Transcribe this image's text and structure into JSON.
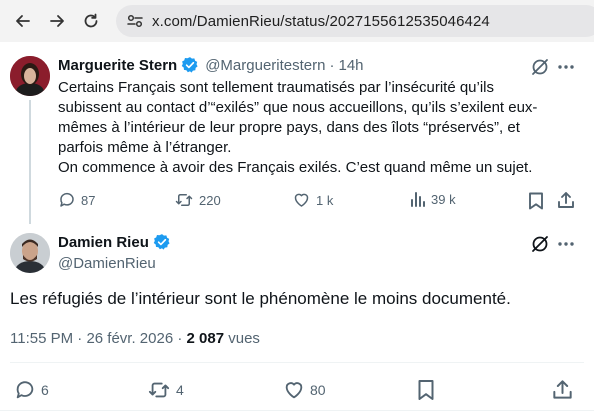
{
  "browser": {
    "url": "x.com/DamienRieu/status/2027155612535046424"
  },
  "parent_tweet": {
    "author_name": "Marguerite Stern",
    "author_handle": "@Margueritestern",
    "separator": "·",
    "time_ago": "14h",
    "text_lines": [
      "Certains Français sont tellement traumatisés par l’insécurité qu’ils",
      "subissent au contact d’“exilés” que nous accueillons, qu’ils s’exilent eux-",
      "mêmes à l’intérieur de leur propre pays, dans des îlots “préservés”, et",
      "parfois même à l’étranger.",
      "On commence à avoir des Français exilés. C’est quand même un sujet."
    ],
    "replies": "87",
    "reposts": "220",
    "likes": "1 k",
    "views": "39 k"
  },
  "main_tweet": {
    "author_name": "Damien Rieu",
    "author_handle": "@DamienRieu",
    "text": "Les réfugiés de l’intérieur sont le phénomène le moins documenté.",
    "time": "11:55 PM",
    "separator": "·",
    "date": "26 févr. 2026",
    "views_count": "2 087",
    "views_label": "vues",
    "replies": "6",
    "reposts": "4",
    "likes": "80"
  },
  "colors": {
    "verified": "#1d9bf0",
    "muted": "#536471",
    "text": "#0f1419"
  }
}
